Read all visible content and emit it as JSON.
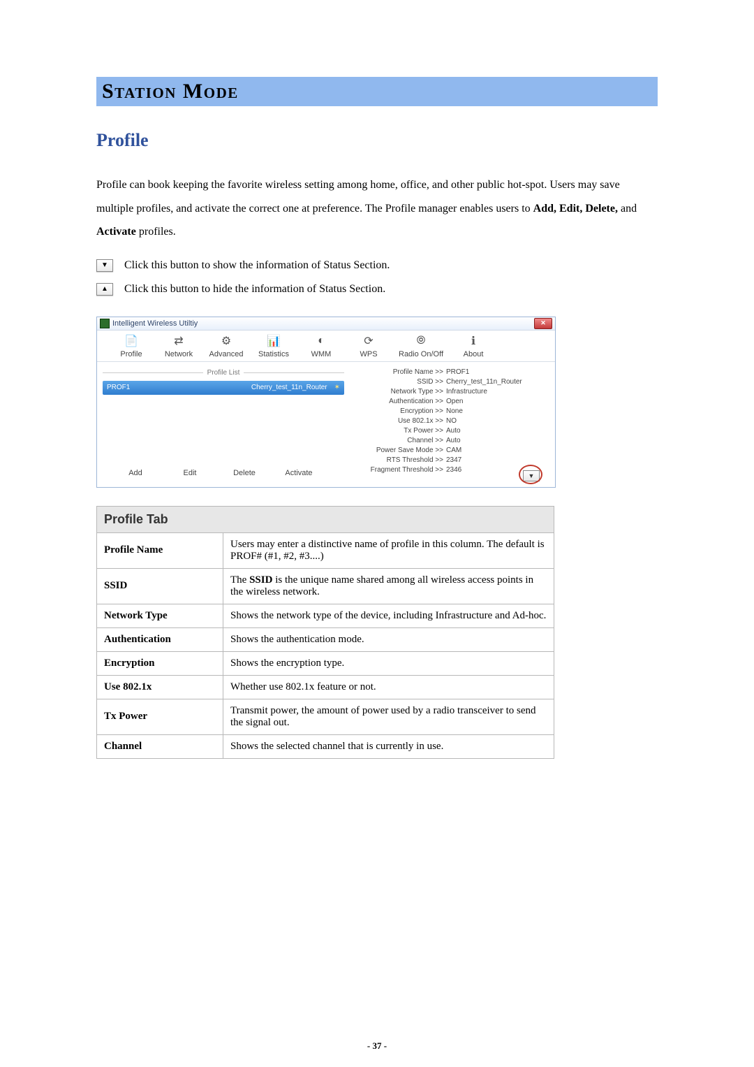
{
  "headings": {
    "banner": "Station Mode",
    "section": "Profile"
  },
  "intro": {
    "part1": "Profile can book keeping the favorite wireless setting among home, office, and other public hot-spot. Users may save multiple profiles, and activate the correct one at preference. The Profile manager enables users to ",
    "bold": "Add, Edit, Delete,",
    "part2": " and ",
    "bold2": "Activate",
    "part3": " profiles."
  },
  "bullets": {
    "down": "Click this button to show the information of Status Section.",
    "up": "Click this button to hide the information of Status Section."
  },
  "app": {
    "title": "Intelligent Wireless Utiltiy",
    "tabs": {
      "profile": "Profile",
      "network": "Network",
      "advanced": "Advanced",
      "statistics": "Statistics",
      "wmm": "WMM",
      "wps": "WPS",
      "radio": "Radio On/Off",
      "about": "About"
    },
    "list_heading": "Profile List",
    "selected": {
      "name": "PROF1",
      "ssid": "Cherry_test_11n_Router"
    },
    "actions": {
      "add": "Add",
      "edit": "Edit",
      "delete": "Delete",
      "activate": "Activate"
    },
    "details": {
      "profile_name": {
        "k": "Profile Name >>",
        "v": "PROF1"
      },
      "ssid": {
        "k": "SSID >>",
        "v": "Cherry_test_11n_Router"
      },
      "network_type": {
        "k": "Network Type >>",
        "v": "Infrastructure"
      },
      "auth": {
        "k": "Authentication >>",
        "v": "Open"
      },
      "encryption": {
        "k": "Encryption >>",
        "v": "None"
      },
      "use8021x": {
        "k": "Use 802.1x >>",
        "v": "NO"
      },
      "txpower": {
        "k": "Tx Power >>",
        "v": "Auto"
      },
      "channel": {
        "k": "Channel >>",
        "v": "Auto"
      },
      "psm": {
        "k": "Power Save Mode >>",
        "v": "CAM"
      },
      "rts": {
        "k": "RTS Threshold >>",
        "v": "2347"
      },
      "frag": {
        "k": "Fragment Threshold >>",
        "v": "2346"
      }
    }
  },
  "profile_tab": {
    "header": "Profile Tab",
    "rows": [
      {
        "k": "Profile Name",
        "v": "Users may enter a distinctive name of profile in this column. The default is PROF# (#1, #2, #3....)"
      },
      {
        "k": "SSID",
        "v_pre": "The ",
        "v_b": "SSID",
        "v_post": " is the unique name shared among all wireless access points in the wireless network."
      },
      {
        "k": "Network Type",
        "v": "Shows the network type of the device, including Infrastructure and Ad-hoc."
      },
      {
        "k": "Authentication",
        "v": "Shows the authentication mode."
      },
      {
        "k": "Encryption",
        "v": "Shows the encryption type."
      },
      {
        "k": "Use 802.1x",
        "v": "Whether use 802.1x feature or not."
      },
      {
        "k": "Tx Power",
        "v": "Transmit power, the amount of power used by a radio transceiver to send the signal out."
      },
      {
        "k": "Channel",
        "v": "Shows the selected channel that is currently in use."
      }
    ]
  },
  "page_number": "- 37 -"
}
